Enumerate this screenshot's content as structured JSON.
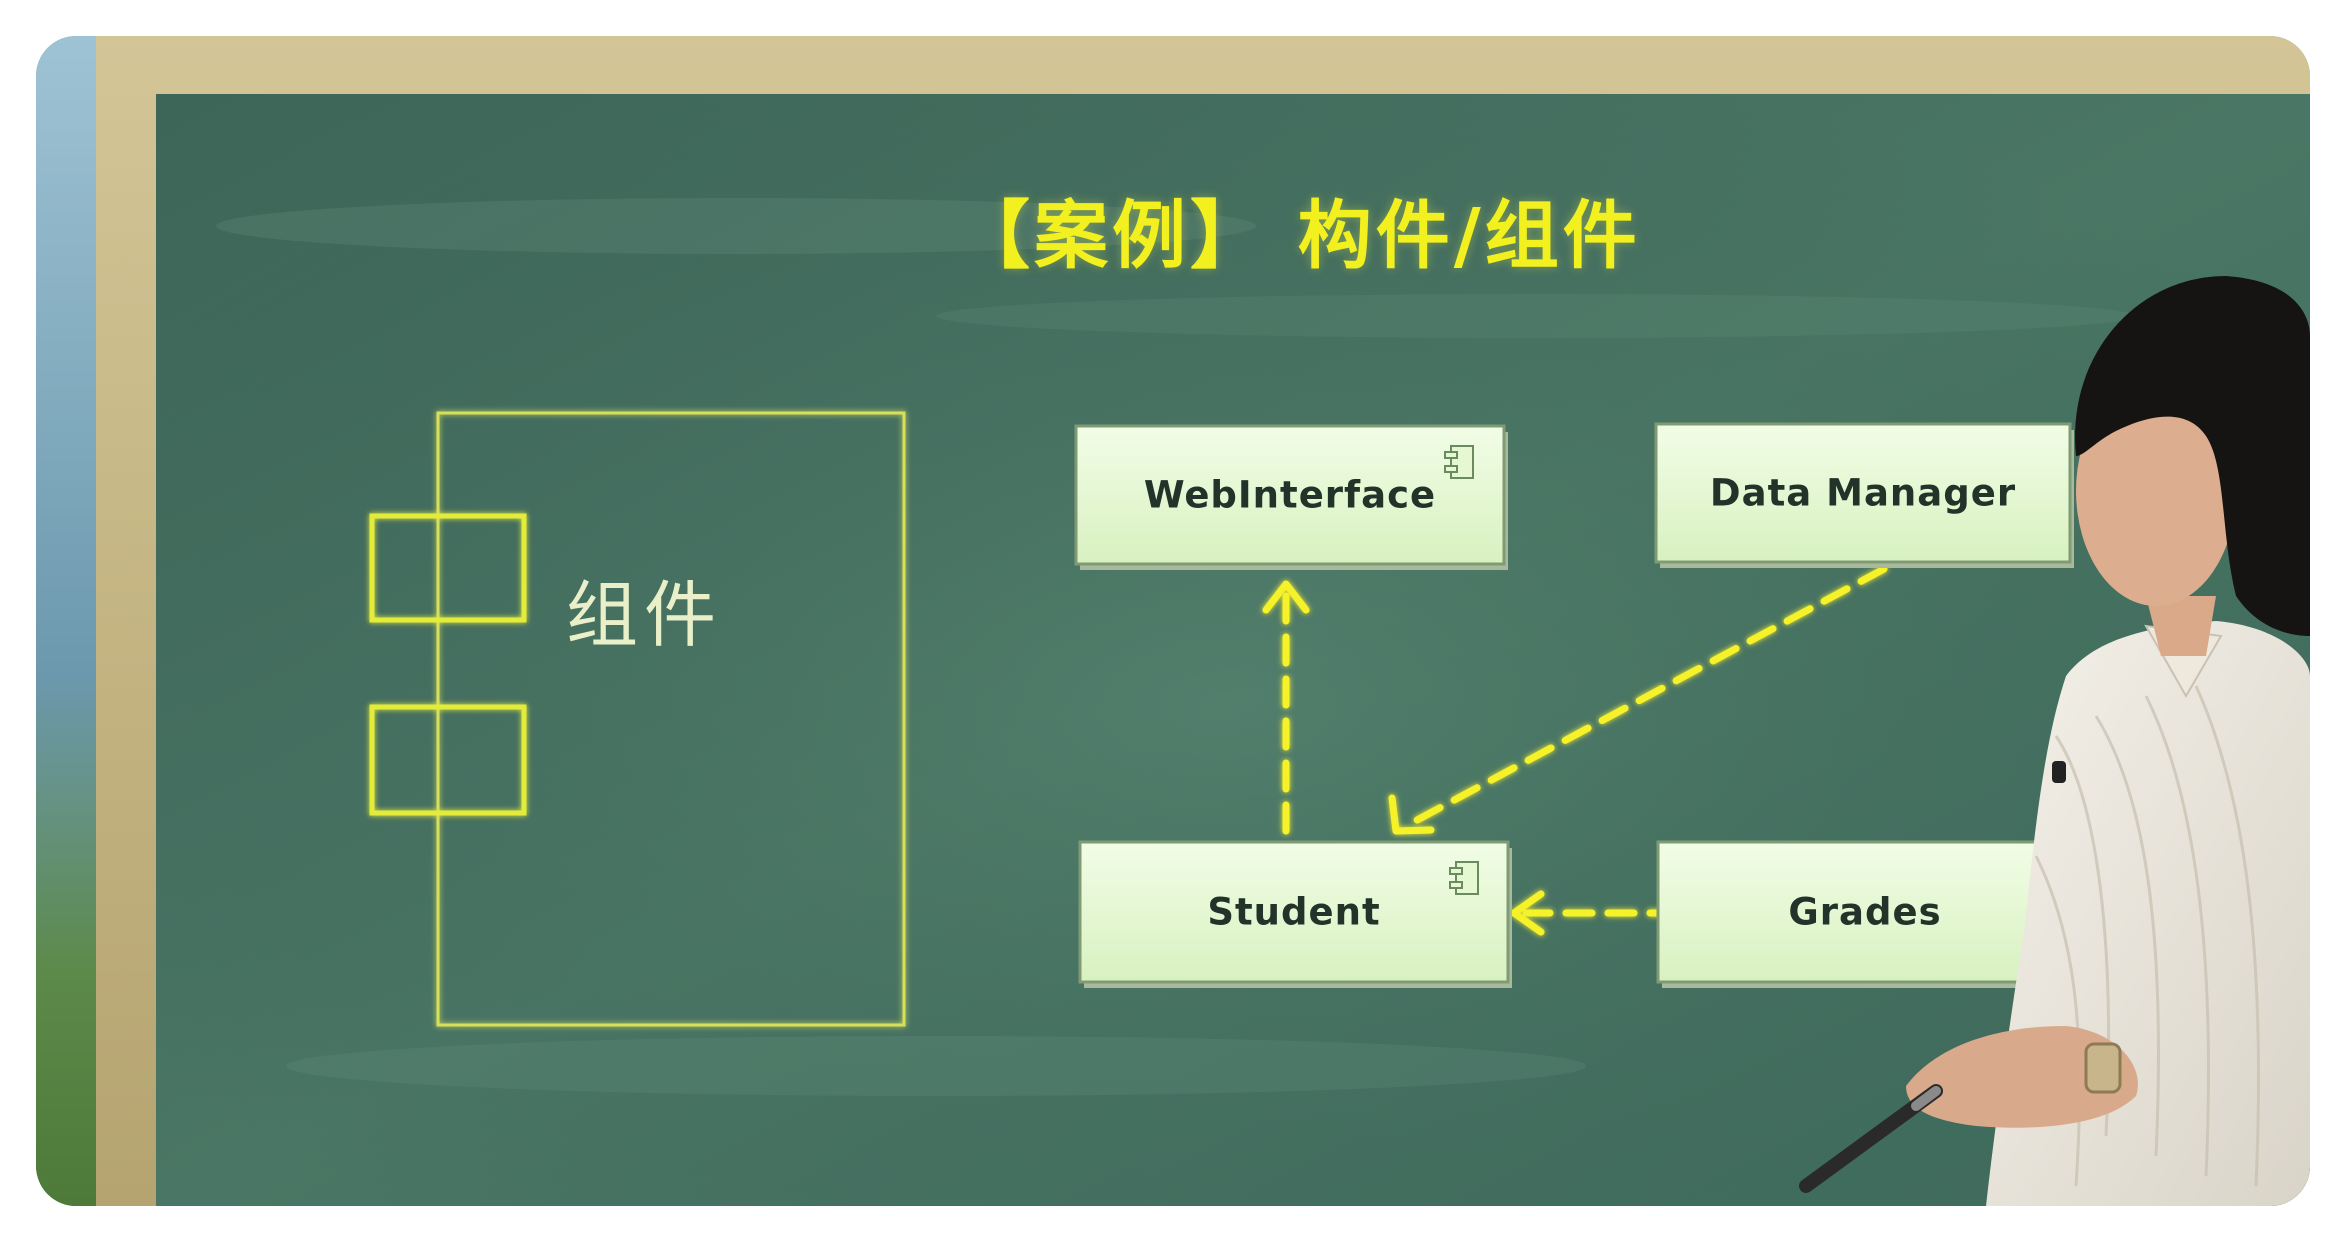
{
  "title": "【案例】 构件/组件",
  "notation": {
    "label": "组件"
  },
  "diagram": {
    "components": [
      {
        "id": "webinterface",
        "label": "WebInterface"
      },
      {
        "id": "data-manager",
        "label": "Data Manager"
      },
      {
        "id": "student",
        "label": "Student"
      },
      {
        "id": "grades",
        "label": "Grades"
      }
    ],
    "dependencies": [
      {
        "from": "Student",
        "to": "WebInterface"
      },
      {
        "from": "Data Manager",
        "to": "Student"
      },
      {
        "from": "Grades",
        "to": "Student"
      }
    ]
  },
  "colors": {
    "board": "#3f6a5e",
    "frame_wood": "#c8b98a",
    "chalk_yellow": "#f2f01f",
    "box_fill": "#e6f8d2",
    "arrow": "#f6f22a"
  }
}
